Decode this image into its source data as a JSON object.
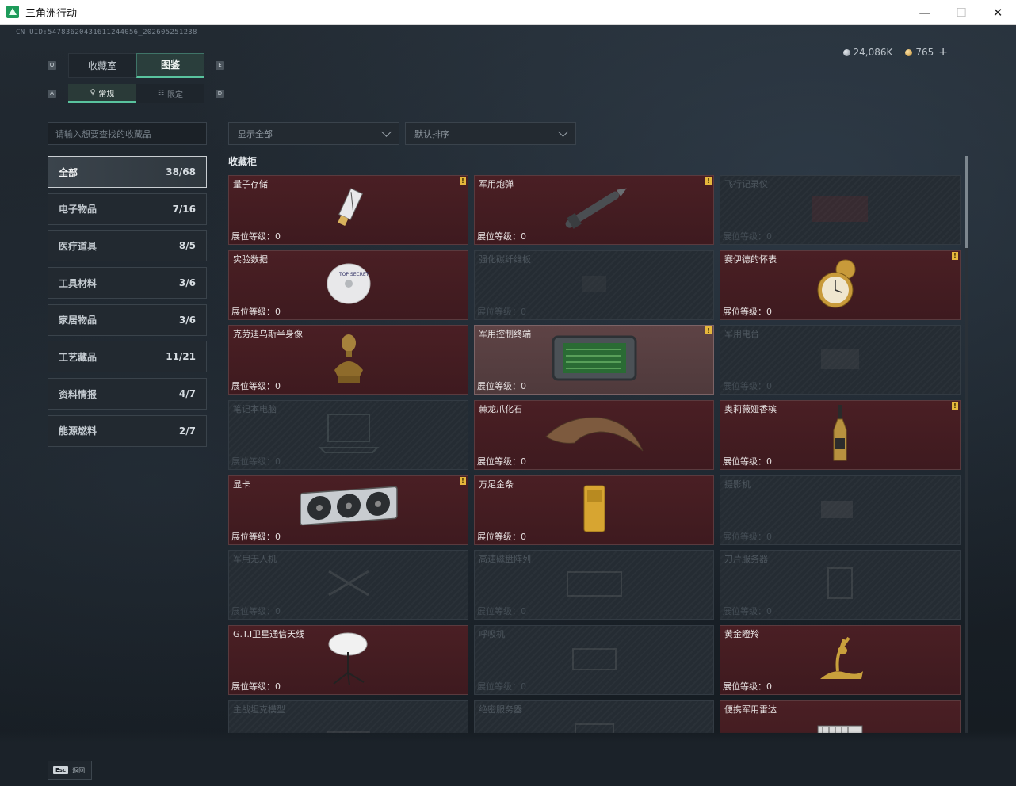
{
  "window": {
    "title": "三角洲行动",
    "minimize": "—",
    "maximize": "☐",
    "close": "✕"
  },
  "uid": "CN UID:5478362043161124405​6_202605251238",
  "currency": {
    "silver": "24,086K",
    "gold": "765",
    "add": "+"
  },
  "tabs": {
    "main": [
      {
        "label": "收藏室",
        "active": false
      },
      {
        "label": "图鉴",
        "active": true
      }
    ],
    "sub": [
      {
        "label": "常规",
        "active": true
      },
      {
        "label": "限定",
        "active": false
      }
    ],
    "keyhints": [
      "Q",
      "E",
      "A",
      "D"
    ]
  },
  "search": {
    "placeholder": "请输入想要查找的收藏品"
  },
  "filters": {
    "show": "显示全部",
    "sort": "默认排序"
  },
  "categories": [
    {
      "label": "全部",
      "count": "38/68"
    },
    {
      "label": "电子物品",
      "count": "7/16"
    },
    {
      "label": "医疗道具",
      "count": "8/5"
    },
    {
      "label": "工具材料",
      "count": "3/6"
    },
    {
      "label": "家居物品",
      "count": "3/6"
    },
    {
      "label": "工艺藏品",
      "count": "11/21"
    },
    {
      "label": "资料情报",
      "count": "4/7"
    },
    {
      "label": "能源燃料",
      "count": "2/7"
    }
  ],
  "section_title": "收藏柜",
  "level_label": "展位等级：0",
  "new_mark": "!",
  "items": [
    {
      "name": "量子存储",
      "owned": true,
      "new": true,
      "icon": "usb-drive-icon"
    },
    {
      "name": "军用炮弹",
      "owned": true,
      "new": true,
      "icon": "missile-icon"
    },
    {
      "name": "飞行记录仪",
      "owned": false,
      "new": false,
      "icon": "flight-recorder-icon"
    },
    {
      "name": "实验数据",
      "owned": true,
      "new": false,
      "icon": "disc-icon"
    },
    {
      "name": "强化碳纤维板",
      "owned": false,
      "new": false,
      "icon": "carbon-plate-icon"
    },
    {
      "name": "赛伊德的怀表",
      "owned": true,
      "new": true,
      "icon": "pocket-watch-icon"
    },
    {
      "name": "克劳迪乌斯半身像",
      "owned": true,
      "new": false,
      "icon": "bust-icon"
    },
    {
      "name": "军用控制终端",
      "owned": true,
      "new": true,
      "icon": "terminal-icon",
      "highlight": true
    },
    {
      "name": "军用电台",
      "owned": false,
      "new": false,
      "icon": "radio-icon"
    },
    {
      "name": "笔记本电脑",
      "owned": false,
      "new": false,
      "icon": "laptop-icon"
    },
    {
      "name": "棘龙爪化石",
      "owned": true,
      "new": false,
      "icon": "claw-fossil-icon"
    },
    {
      "name": "奥莉薇娅香槟",
      "owned": true,
      "new": true,
      "icon": "champagne-icon"
    },
    {
      "name": "显卡",
      "owned": true,
      "new": true,
      "icon": "gpu-icon"
    },
    {
      "name": "万足金条",
      "owned": true,
      "new": false,
      "icon": "gold-bar-icon"
    },
    {
      "name": "摄影机",
      "owned": false,
      "new": false,
      "icon": "camera-icon"
    },
    {
      "name": "军用无人机",
      "owned": false,
      "new": false,
      "icon": "drone-icon"
    },
    {
      "name": "高速磁盘阵列",
      "owned": false,
      "new": false,
      "icon": "disk-array-icon"
    },
    {
      "name": "刀片服务器",
      "owned": false,
      "new": false,
      "icon": "blade-server-icon"
    },
    {
      "name": "G.T.I卫星通信天线",
      "owned": true,
      "new": false,
      "icon": "satellite-dish-icon"
    },
    {
      "name": "呼吸机",
      "owned": false,
      "new": false,
      "icon": "ventilator-icon"
    },
    {
      "name": "黄金瞪羚",
      "owned": true,
      "new": false,
      "icon": "gold-gazelle-icon"
    },
    {
      "name": "主战坦克模型",
      "owned": false,
      "new": false,
      "icon": "tank-model-icon"
    },
    {
      "name": "绝密服务器",
      "owned": false,
      "new": false,
      "icon": "server-icon"
    },
    {
      "name": "便携军用雷达",
      "owned": true,
      "new": false,
      "icon": "radar-icon"
    }
  ],
  "footer": {
    "esc_key": "Esc",
    "esc_label": "返回"
  },
  "colors": {
    "accent": "#59c39e",
    "owned_card": "#4a1f24",
    "locked_card": "#252c33",
    "new_badge": "#e6b73c"
  }
}
